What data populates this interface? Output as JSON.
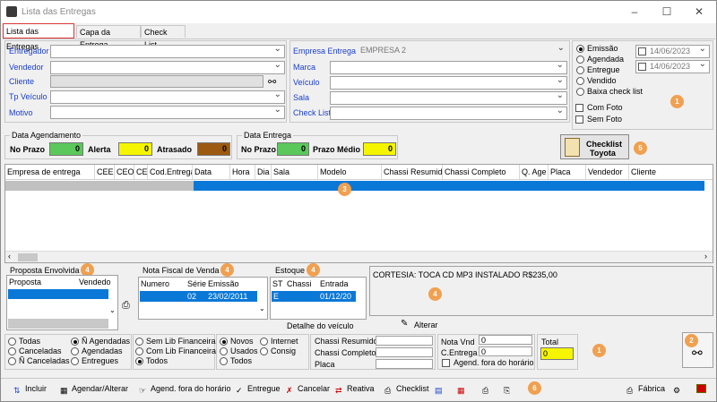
{
  "window": {
    "title": "Lista das Entregas",
    "minimize": "–",
    "maximize": "☐",
    "close": "✕"
  },
  "tabs": [
    {
      "label": "Lista das Entregas"
    },
    {
      "label": "Capa da Entrega"
    },
    {
      "label": "Check List"
    }
  ],
  "filters": {
    "entregador": "Entregador",
    "vendedor": "Vendedor",
    "cliente": "Cliente",
    "tp_veiculo": "Tp Veículo",
    "motivo": "Motivo",
    "empresa_entrega": "Empresa Entrega",
    "empresa_value": "EMPRESA 2",
    "marca": "Marca",
    "veiculo": "Veículo",
    "sala": "Sala",
    "check_list": "Check List"
  },
  "date_options": {
    "emissao": "Emissão",
    "agendada": "Agendada",
    "entregue": "Entregue",
    "vendido": "Vendido",
    "baixa": "Baixa check list",
    "com_foto": "Com Foto",
    "sem_foto": "Sem Foto",
    "date1": "14/06/2023",
    "date2": "14/06/2023"
  },
  "agendamento": {
    "title": "Data Agendamento",
    "no_prazo": "No Prazo",
    "no_prazo_val": "0",
    "alerta": "Alerta",
    "alerta_val": "0",
    "atrasado": "Atrasado",
    "atrasado_val": "0"
  },
  "entrega": {
    "title": "Data Entrega",
    "no_prazo": "No Prazo",
    "no_prazo_val": "0",
    "prazo_medio": "Prazo Médio",
    "prazo_medio_val": "0"
  },
  "checklist_btn": {
    "line1": "Checklist",
    "line2": "Toyota"
  },
  "grid": {
    "columns": [
      "Empresa de entrega",
      "CEE",
      "CEO",
      "CE",
      "Cod.Entrega",
      "Data",
      "Hora",
      "Dia",
      "Sala",
      "Modelo",
      "Chassi Resumido",
      "Chassi Completo",
      "Q. Age",
      "Placa",
      "Vendedor",
      "Cliente"
    ]
  },
  "proposta": {
    "title": "Proposta Envolvida",
    "col1": "Proposta",
    "col2": "Vendedo"
  },
  "nota": {
    "title": "Nota Fiscal de Venda",
    "cols": [
      "Numero",
      "Série",
      "Emissão"
    ],
    "serie": "02",
    "emissao": "23/02/2011"
  },
  "estoque": {
    "title": "Estoque",
    "cols": [
      "ST",
      "Chassi",
      "Entrada"
    ],
    "st": "E",
    "entrada": "01/12/20",
    "detalhe": "Detalhe do veículo"
  },
  "obs": {
    "text": "CORTESIA: TOCA CD MP3  INSTALADO R$235,00",
    "alterar": "Alterar"
  },
  "status_filters": {
    "todas": "Todas",
    "n_agendadas": "Ñ Agendadas",
    "canceladas": "Canceladas",
    "agendadas": "Agendadas",
    "n_canceladas": "Ñ Canceladas",
    "entregues": "Entregues",
    "sem_lib": "Sem Lib Financeira",
    "com_lib": "Com Lib Financeira",
    "todos": "Todos",
    "novos": "Novos",
    "internet": "Internet",
    "usados": "Usados",
    "consig": "Consig",
    "todos2": "Todos"
  },
  "chassi": {
    "resumido": "Chassi Resumido",
    "completo": "Chassi Completo",
    "placa": "Placa"
  },
  "nota_vnd": {
    "label": "Nota Vnd",
    "value": "0",
    "c_entrega": "C.Entrega",
    "c_entrega_val": "0",
    "agend": "Agend. fora do horário"
  },
  "total": {
    "label": "Total",
    "value": "0"
  },
  "toolbar": {
    "incluir": "Incluir",
    "agendar": "Agendar/Alterar",
    "agend_fora": "Agend. fora do horário",
    "entregue": "Entregue",
    "cancelar": "Cancelar",
    "reativa": "Reativa",
    "checklist": "Checklist",
    "fabrica": "Fábrica"
  },
  "badges": {
    "b1": "1",
    "b2": "2",
    "b3": "3",
    "b4": "4",
    "b5": "5",
    "b6": "6"
  },
  "colors": {
    "green": "#5ac85a",
    "yellow": "#f5f500",
    "brown": "#9c5a10",
    "selection": "#0a78d7",
    "badge": "#f0a050"
  }
}
